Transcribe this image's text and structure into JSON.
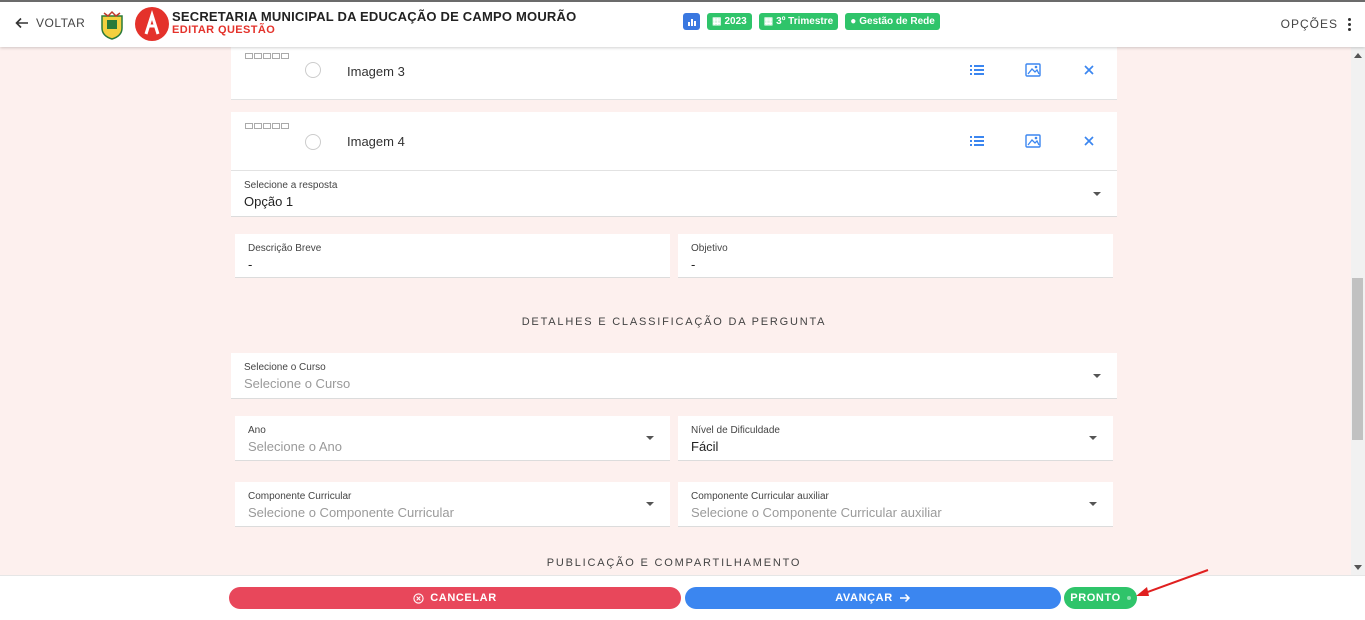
{
  "header": {
    "back_label": "VOLTAR",
    "title": "SECRETARIA MUNICIPAL DA EDUCAÇÃO DE CAMPO MOURÃO",
    "subtitle": "EDITAR QUESTÃO",
    "badges": [
      "2023",
      "3º Trimestre",
      "Gestão de Rede"
    ],
    "options_label": "OPÇÕES"
  },
  "options": [
    {
      "label": "Imagem 3"
    },
    {
      "label": "Imagem 4"
    }
  ],
  "answer": {
    "label": "Selecione a resposta",
    "value": "Opção 1"
  },
  "description": {
    "label": "Descrição Breve",
    "value": "-"
  },
  "objective": {
    "label": "Objetivo",
    "value": "-"
  },
  "section_details": "DETALHES E CLASSIFICAÇÃO DA PERGUNTA",
  "course": {
    "label": "Selecione o Curso",
    "placeholder": "Selecione o Curso"
  },
  "year": {
    "label": "Ano",
    "placeholder": "Selecione o Ano"
  },
  "difficulty": {
    "label": "Nível de Dificuldade",
    "value": "Fácil"
  },
  "component": {
    "label": "Componente Curricular",
    "placeholder": "Selecione o Componente Curricular"
  },
  "component_aux": {
    "label": "Componente Curricular auxiliar",
    "placeholder": "Selecione o Componente Curricular auxiliar"
  },
  "section_publish": "PUBLICAÇÃO E COMPARTILHAMENTO",
  "footer": {
    "cancel_label": "CANCELAR",
    "next_label": "AVANÇAR",
    "done_label": "PRONTO"
  },
  "colors": {
    "accent_blue": "#3b86f0",
    "danger": "#e8475b",
    "success": "#2fc46a",
    "brand_red": "#e4322b",
    "page_bg": "#fdf0ee"
  }
}
